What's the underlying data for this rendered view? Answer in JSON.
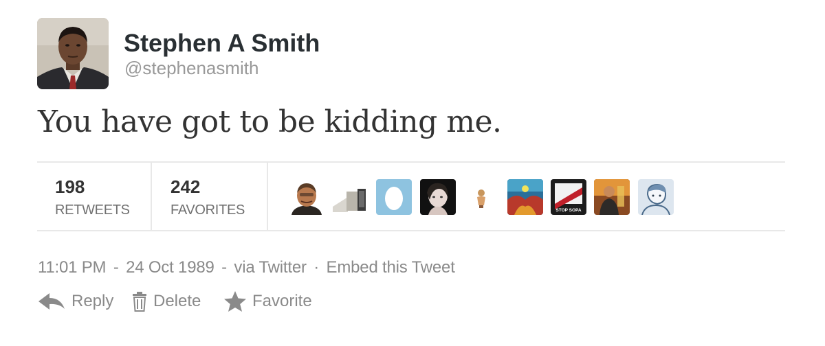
{
  "author": {
    "name": "Stephen A Smith",
    "handle": "@stephenasmith"
  },
  "tweet": {
    "text": "You have got to be kidding me."
  },
  "stats": {
    "retweets_count": "198",
    "retweets_label": "RETWEETS",
    "favorites_count": "242",
    "favorites_label": "FAVORITES"
  },
  "favoriters": [
    {
      "icon": "older-man-avatar"
    },
    {
      "icon": "device-photo-avatar"
    },
    {
      "icon": "default-egg-avatar"
    },
    {
      "icon": "dark-portrait-avatar"
    },
    {
      "icon": "small-figure-avatar"
    },
    {
      "icon": "colorful-art-avatar"
    },
    {
      "icon": "stop-sopa-avatar",
      "text": "STOP SOPA"
    },
    {
      "icon": "performer-avatar"
    },
    {
      "icon": "sketch-character-avatar"
    }
  ],
  "meta": {
    "time": "11:01 PM",
    "date": "24 Oct 1989",
    "via_prefix": "via",
    "source": "Twitter",
    "embed": "Embed this Tweet"
  },
  "actions": {
    "reply": "Reply",
    "delete": "Delete",
    "favorite": "Favorite"
  },
  "colors": {
    "text": "#333333",
    "muted": "#8a8a8a",
    "divider": "#e8e8e8",
    "egg_bg": "#8ec3e0"
  }
}
